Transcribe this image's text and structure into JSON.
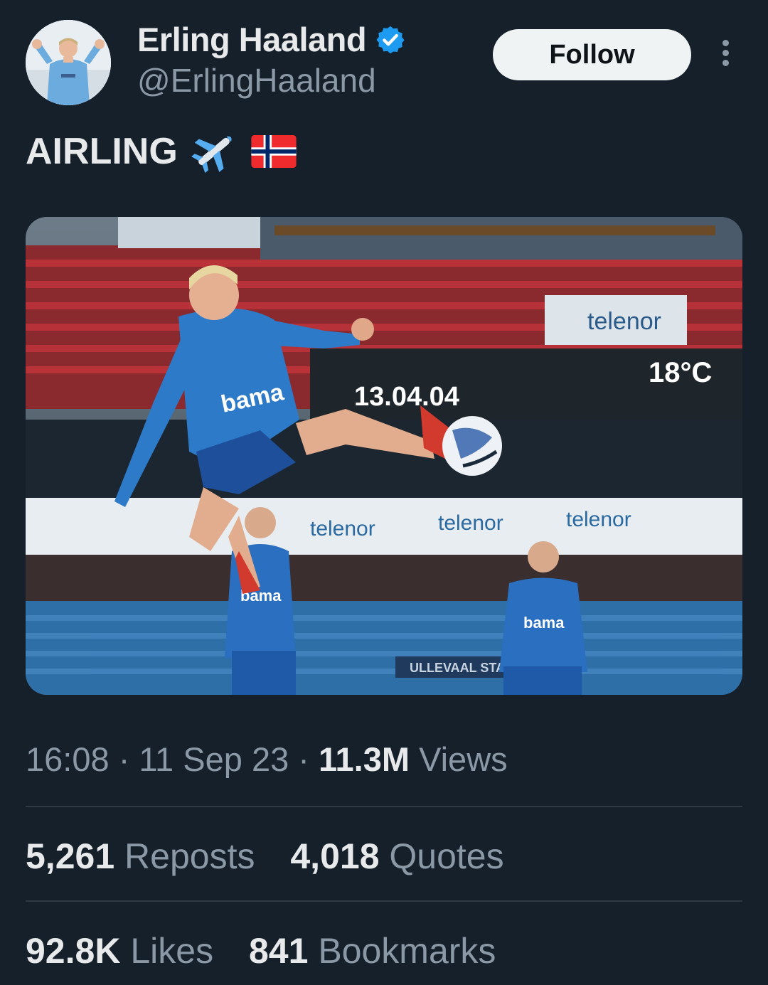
{
  "user": {
    "display_name": "Erling Haaland",
    "handle": "@ErlingHaaland",
    "verified_icon": "verified-badge-icon",
    "avatar": "avatar-image"
  },
  "actions": {
    "follow_label": "Follow",
    "more_icon": "more-vertical-icon"
  },
  "tweet": {
    "text_main": "AIR",
    "text_smallcaps": "LING",
    "emojis": [
      "airplane-icon",
      "norway-flag-icon"
    ]
  },
  "media": {
    "scoreboard_time": "13.04.04",
    "scoreboard_temp": "18°C",
    "shirt_sponsor": "bama",
    "board_sponsor": "telenor",
    "stadium_sign": "ULLEVAAL STA"
  },
  "meta": {
    "time": "16:08",
    "sep": "·",
    "date": "11 Sep 23",
    "views_count": "11.3M",
    "views_label": "Views"
  },
  "stats": [
    {
      "count": "5,261",
      "label": "Reposts"
    },
    {
      "count": "4,018",
      "label": "Quotes"
    },
    {
      "count": "92.8K",
      "label": "Likes"
    },
    {
      "count": "841",
      "label": "Bookmarks"
    }
  ],
  "colors": {
    "background": "#15202b",
    "text_primary": "#e7e9ea",
    "text_secondary": "#8b98a5",
    "verified_blue": "#1d9bf0",
    "follow_bg": "#eff3f4",
    "divider": "#2f3a45"
  }
}
